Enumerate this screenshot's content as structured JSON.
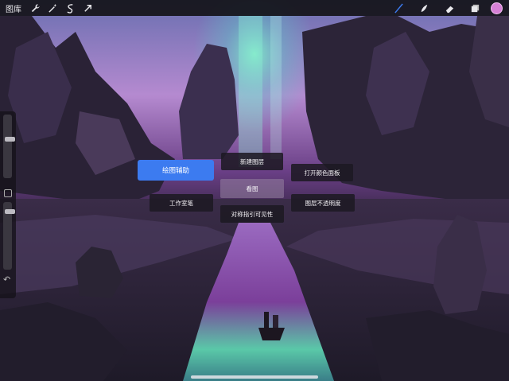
{
  "topbar": {
    "gallery_label": "图库",
    "left_tools": [
      "wrench-icon",
      "magic-wand-icon",
      "selection-icon",
      "transform-arrow-icon"
    ],
    "right_tools": [
      "brush-icon",
      "smudge-icon",
      "eraser-icon",
      "layers-icon"
    ],
    "current_color": "#d680d6",
    "active_tool_color": "#3c7bf0"
  },
  "sidebar": {
    "brush_size_level": 0.22,
    "opacity_level": 0.12
  },
  "quick_menu": {
    "drawing_guide": "绘图辅助",
    "new_layer": "新建图层",
    "open_color_panel": "打开颜色面板",
    "view": "看图",
    "workspace": "工作室笔",
    "layer_opacity": "图层不透明度",
    "symmetry_guide_visibility": "对称指引可见性"
  }
}
